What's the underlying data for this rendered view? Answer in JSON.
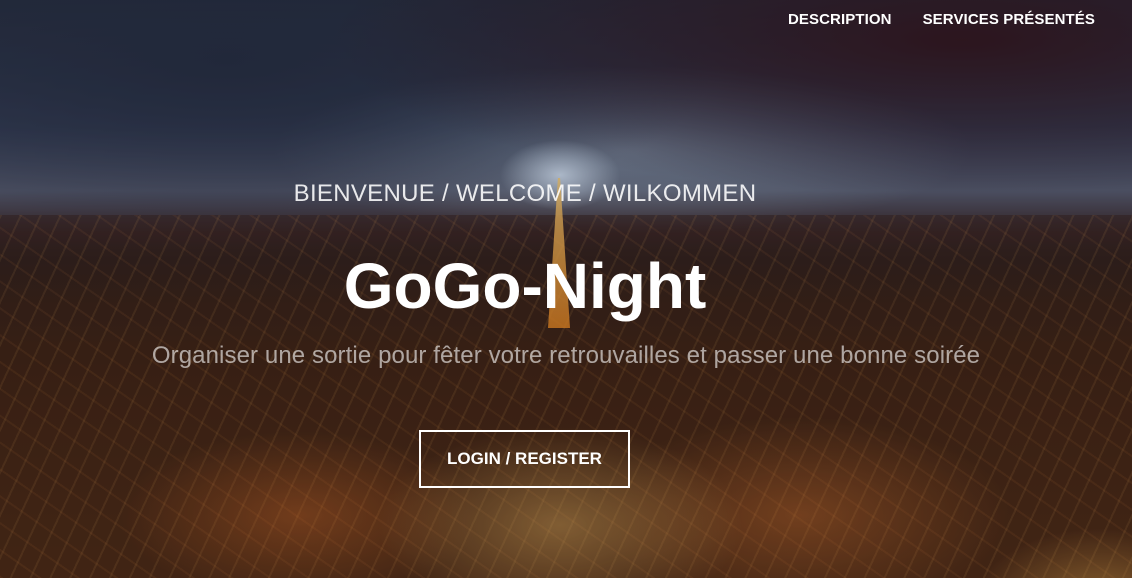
{
  "nav": {
    "items": [
      {
        "label": "DESCRIPTION"
      },
      {
        "label": "SERVICES PRÉSENTÉS"
      }
    ]
  },
  "hero": {
    "welcome": "BIENVENUE / WELCOME / WILKOMMEN",
    "title": "GoGo-Night",
    "tagline": "Organiser une sortie pour fêter votre retrouvailles et passer une bonne soirée",
    "cta_label": "LOGIN / REGISTER"
  },
  "colors": {
    "text": "#ffffff",
    "button_border": "#ffffff"
  }
}
